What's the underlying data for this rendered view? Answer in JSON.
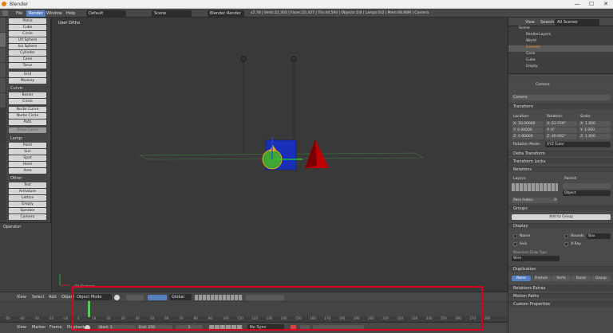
{
  "title": "Blender",
  "window_controls": [
    "—",
    "☐",
    "✕"
  ],
  "info": {
    "menus": [
      "File",
      "Render",
      "Window",
      "Help"
    ],
    "screen": "Default",
    "scene": "Scene",
    "engine": "Blender Render",
    "stats": "v2.78 | Verts:22,303 | Faces:22,437 | Tris:44,594 | Objects:1/8 | Lamps:0/2 | Mem:68.84M | Camera"
  },
  "tabs": [
    "Tools",
    "Create",
    "Relations",
    "Animation",
    "Physics",
    "Grease Pencil"
  ],
  "tools": {
    "mesh": [
      "Plane",
      "Cube",
      "Circle",
      "UV Sphere",
      "Ico Sphere",
      "Cylinder",
      "Cone",
      "Torus"
    ],
    "misc": [
      "Grid",
      "Monkey"
    ],
    "curve_label": "Curve:",
    "curve": [
      "Bezier",
      "Circle",
      "Nurbs Curve",
      "Nurbs Circle",
      "Path"
    ],
    "draw_curve": "Draw Curve",
    "lamp_label": "Lamp:",
    "lamp": [
      "Point",
      "Sun",
      "Spot",
      "Hemi",
      "Area"
    ],
    "other_label": "Other:",
    "other": [
      "Text",
      "Armature",
      "Lattice",
      "Empty",
      "Speaker",
      "Camera"
    ]
  },
  "operator": "Operator",
  "viewport": {
    "label": "User Ortho",
    "object_label": "(1) Camera"
  },
  "viewport_header": {
    "menus": [
      "View",
      "Select",
      "Add",
      "Object"
    ],
    "mode": "Object Mode",
    "orientation": "Global"
  },
  "timeline": {
    "ticks": [
      "-50",
      "-40",
      "-30",
      "-20",
      "-10",
      "0",
      "10",
      "20",
      "30",
      "40",
      "50",
      "60",
      "70",
      "80",
      "90",
      "100",
      "110",
      "120",
      "130",
      "140",
      "150",
      "160",
      "170",
      "180",
      "190",
      "200",
      "210",
      "220",
      "230",
      "240",
      "250",
      "260",
      "270",
      "280"
    ],
    "current_frame": "1"
  },
  "timeline_header": {
    "menus": [
      "View",
      "Marker",
      "Frame",
      "Playback"
    ],
    "start_label": "Start:",
    "start": "1",
    "end_label": "End:",
    "end": "250",
    "frame": "1",
    "sync": "No Sync"
  },
  "outliner": {
    "menus": [
      "View",
      "Search"
    ],
    "filter": "All Scenes",
    "items": [
      "Scene",
      "RenderLayers",
      "World",
      "Camera",
      "Cone",
      "Cube",
      "Empty"
    ]
  },
  "properties": {
    "context": "Camera",
    "name": "Camera",
    "transform": "Transform",
    "location_label": "Location:",
    "location": [
      "X: 10.00000",
      "Y: 0.00000",
      "Z: 0.00000"
    ],
    "rotation_label": "Rotation:",
    "rotation": [
      "X: 63.559°",
      "Y: 0°",
      "Z: 46.692°"
    ],
    "scale_label": "Scale:",
    "scale": [
      "X: 1.000",
      "Y: 1.000",
      "Z: 1.000"
    ],
    "rotation_mode_label": "Rotation Mode:",
    "rotation_mode": "XYZ Euler",
    "sections1": [
      "Delta Transform",
      "Transform Locks"
    ],
    "relations": "Relations",
    "layers_label": "Layers:",
    "parent_label": "Parent:",
    "parent_type": "Object",
    "pass_index": "Pass Index:",
    "pass_value": "0",
    "groups": "Groups",
    "add_group": "Add to Group",
    "display": "Display",
    "display_opts": [
      "Name",
      "Axis",
      "Bounds",
      "X-Ray"
    ],
    "bounds_type": "Box",
    "max_draw_label": "Maximum Draw Type:",
    "max_draw": "Wire",
    "duplication": "Duplication",
    "dup_opts": [
      "None",
      "Frames",
      "Verts",
      "Faces",
      "Group"
    ],
    "sections2": [
      "Relations Extras",
      "Motion Paths",
      "Custom Properties"
    ]
  },
  "colors": {
    "accent": "#5680c2",
    "highlight": "#d9001b"
  }
}
